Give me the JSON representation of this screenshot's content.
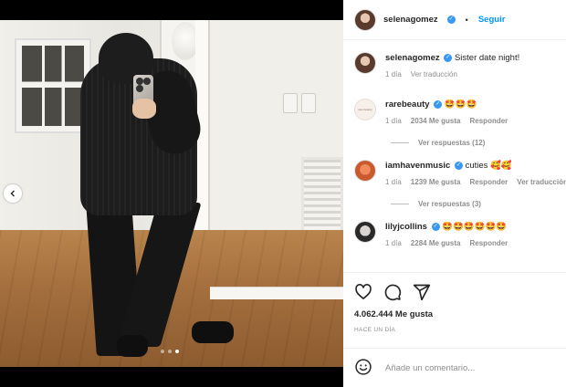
{
  "post": {
    "author": "selenagomez",
    "follow_label": "Seguir",
    "separator": "•",
    "caption": "Sister date night!",
    "caption_age": "1 día",
    "translate_label": "Ver traducción",
    "likes_text": "4.062.444 Me gusta",
    "posted_ago": "HACE UN DÍA",
    "carousel": {
      "total": 3,
      "active_index": 2
    }
  },
  "comments": [
    {
      "username": "rarebeauty",
      "avatar_text": "rare beauty",
      "text": "🤩🤩🤩",
      "age": "1 día",
      "likes": "2034 Me gusta",
      "reply_label": "Responder",
      "translate": "",
      "view_replies": "Ver respuestas (12)"
    },
    {
      "username": "iamhavenmusic",
      "text": "cuties 🥰🥰",
      "age": "1 día",
      "likes": "1239 Me gusta",
      "reply_label": "Responder",
      "translate": "Ver traducción",
      "view_replies": "Ver respuestas (3)"
    },
    {
      "username": "lilyjcollins",
      "text": "🤩🤩🤩🤩🤩🤩",
      "age": "1 día",
      "likes": "2284 Me gusta",
      "reply_label": "Responder",
      "translate": "",
      "view_replies": ""
    }
  ],
  "composer": {
    "placeholder": "Añade un comentario..."
  },
  "icons": {
    "verified": "verified-badge-icon",
    "like": "heart-icon",
    "comment": "comment-bubble-icon",
    "share": "paper-plane-icon",
    "emoji": "smiley-icon",
    "prev": "chevron-left-icon"
  },
  "colors": {
    "link": "#0095f6",
    "verified": "#3897f0",
    "muted": "#8e8e8e",
    "text": "#262626"
  }
}
